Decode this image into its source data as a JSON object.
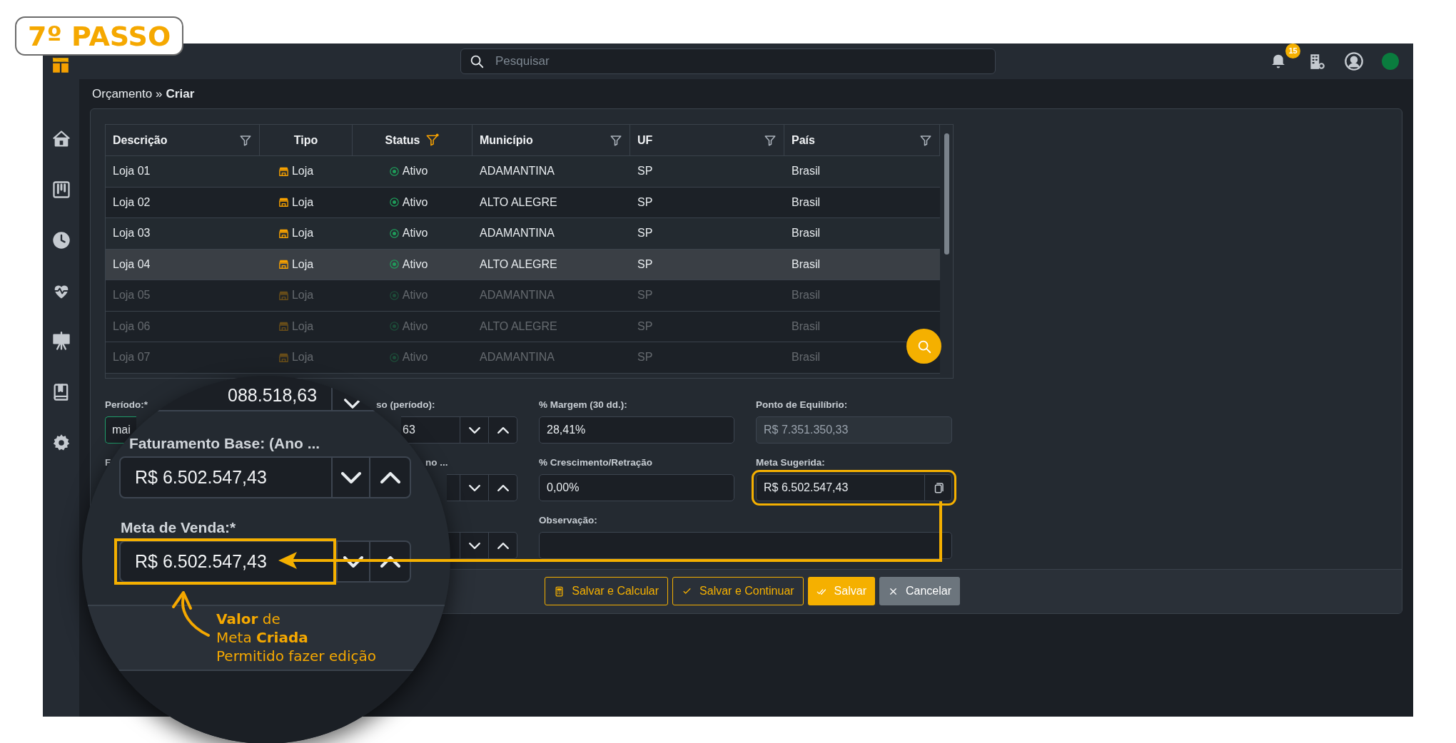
{
  "step_badge": "7º PASSO",
  "topbar": {
    "search_placeholder": "Pesquisar",
    "notification_count": "15",
    "online": true
  },
  "breadcrumb": {
    "parent": "Orçamento",
    "separator": "»",
    "current": "Criar"
  },
  "table": {
    "columns": [
      {
        "label": "Descrição",
        "has_filter": true,
        "filter_active": false
      },
      {
        "label": "Tipo",
        "has_filter": false
      },
      {
        "label": "Status",
        "has_filter": true,
        "filter_active": true
      },
      {
        "label": "Município",
        "has_filter": true,
        "filter_active": false
      },
      {
        "label": "UF",
        "has_filter": true,
        "filter_active": false
      },
      {
        "label": "País",
        "has_filter": true,
        "filter_active": false
      }
    ],
    "rows": [
      {
        "descricao": "Loja 01",
        "tipo": "Loja",
        "status": "Ativo",
        "municipio": "ADAMANTINA",
        "uf": "SP",
        "pais": "Brasil",
        "selected": false,
        "faded": false
      },
      {
        "descricao": "Loja 02",
        "tipo": "Loja",
        "status": "Ativo",
        "municipio": "ALTO ALEGRE",
        "uf": "SP",
        "pais": "Brasil",
        "selected": false,
        "faded": false
      },
      {
        "descricao": "Loja 03",
        "tipo": "Loja",
        "status": "Ativo",
        "municipio": "ADAMANTINA",
        "uf": "SP",
        "pais": "Brasil",
        "selected": false,
        "faded": false
      },
      {
        "descricao": "Loja 04",
        "tipo": "Loja",
        "status": "Ativo",
        "municipio": "ALTO ALEGRE",
        "uf": "SP",
        "pais": "Brasil",
        "selected": true,
        "faded": false
      },
      {
        "descricao": "Loja 05",
        "tipo": "Loja",
        "status": "Ativo",
        "municipio": "ADAMANTINA",
        "uf": "SP",
        "pais": "Brasil",
        "selected": false,
        "faded": true
      },
      {
        "descricao": "Loja 06",
        "tipo": "Loja",
        "status": "Ativo",
        "municipio": "ALTO ALEGRE",
        "uf": "SP",
        "pais": "Brasil",
        "selected": false,
        "faded": true
      },
      {
        "descricao": "Loja 07",
        "tipo": "Loja",
        "status": "Ativo",
        "municipio": "ADAMANTINA",
        "uf": "SP",
        "pais": "Brasil",
        "selected": false,
        "faded": true
      }
    ]
  },
  "form": {
    "periodo": {
      "label": "Período:*",
      "value": "mai"
    },
    "col2_row1": {
      "label": "so (período):",
      "value": "63"
    },
    "row2_col1_label": "F",
    "col2_row2_label": "no ...",
    "margem": {
      "label": "% Margem (30 dd.):",
      "value": "28,41%"
    },
    "ponto_equilibrio": {
      "label": "Ponto de Equilíbrio:",
      "value": "R$ 7.351.350,33",
      "disabled": true
    },
    "crescimento": {
      "label": "% Crescimento/Retração",
      "value": "0,00%"
    },
    "meta_sugerida": {
      "label": "Meta Sugerida:",
      "value": "R$ 6.502.547,43",
      "highlighted": true
    },
    "observacao": {
      "label": "Observação:"
    }
  },
  "buttons": [
    {
      "label": "Salvar e Calcular",
      "kind": "calculate"
    },
    {
      "label": "Salvar e Continuar",
      "kind": "continue"
    },
    {
      "label": "Salvar",
      "kind": "save"
    },
    {
      "label": "Cancelar",
      "kind": "cancel"
    }
  ],
  "magnifier": {
    "top_value": "088.518,63",
    "base": {
      "label": "Faturamento Base: (Ano ...",
      "value": "R$ 6.502.547,43"
    },
    "meta": {
      "label": "Meta de Venda:*",
      "value": "R$ 6.502.547,43",
      "highlighted": true
    }
  },
  "annotation": {
    "lines": [
      "**Valor** de",
      "Meta **Criada**",
      "Permitido fazer edição"
    ]
  }
}
